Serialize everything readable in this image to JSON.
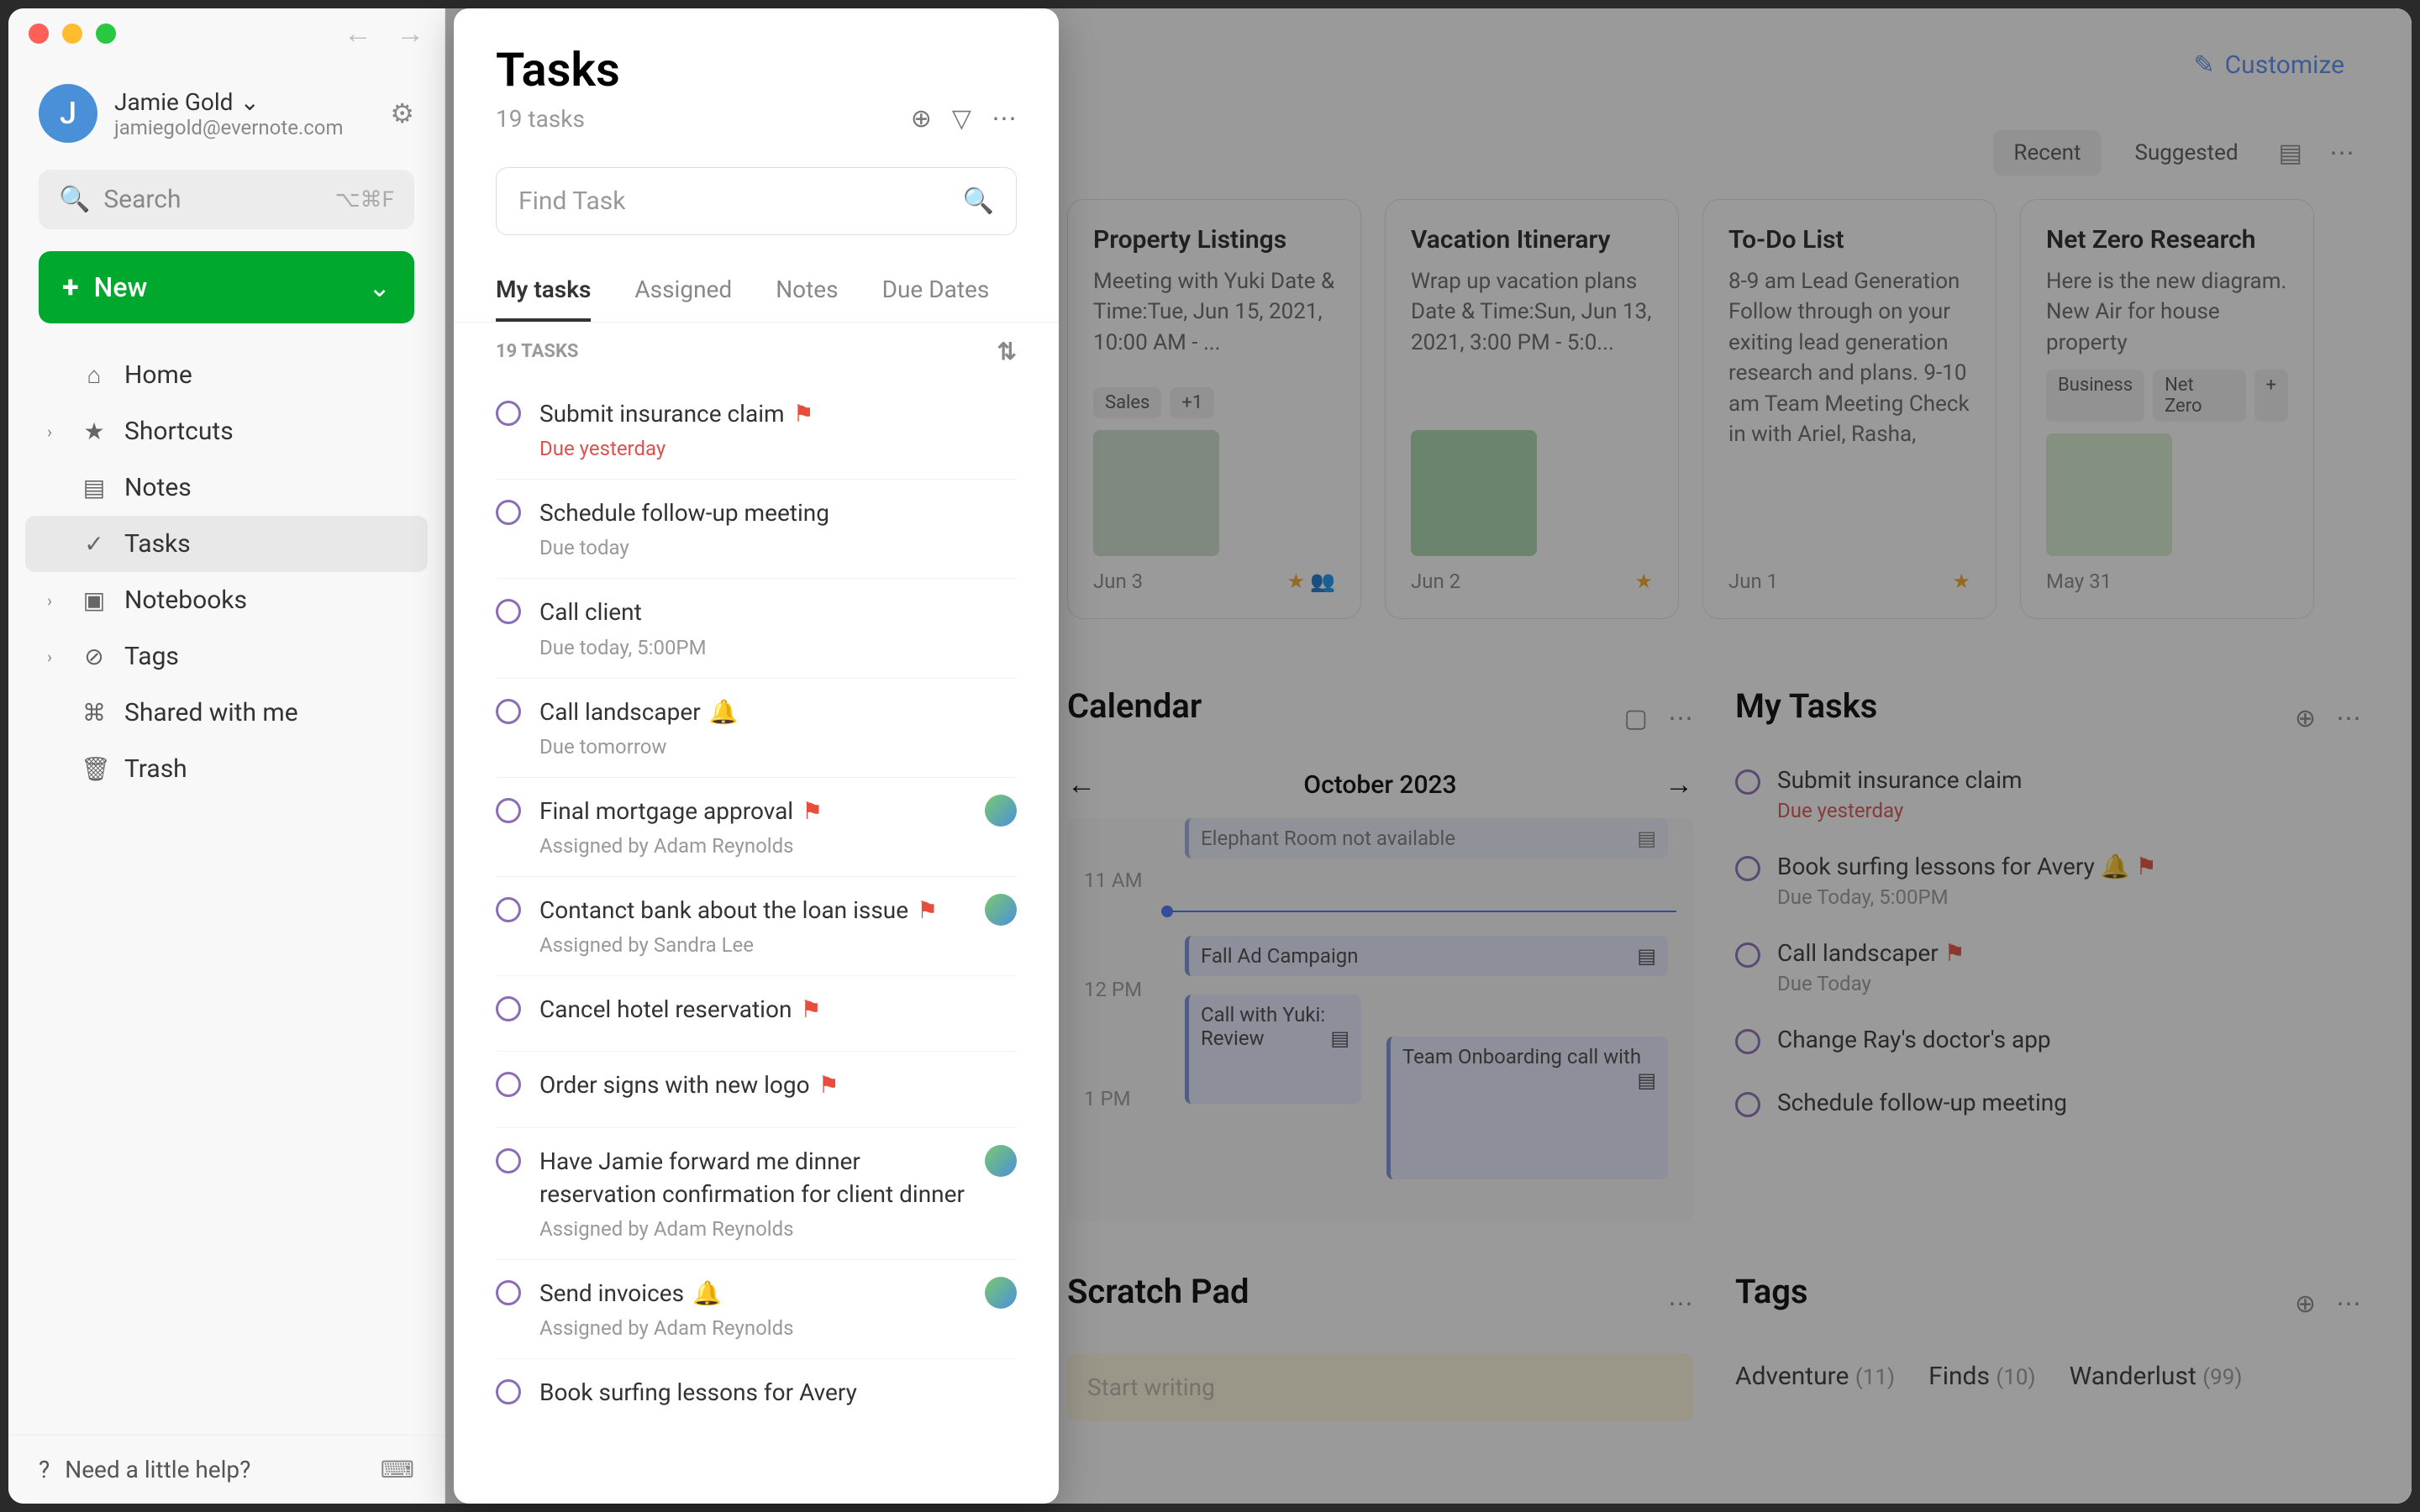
{
  "sidebar": {
    "traffic": [
      "red",
      "yellow",
      "green"
    ],
    "profile": {
      "initial": "J",
      "name": "Jamie Gold",
      "email": "jamiegold@evernote.com"
    },
    "search_placeholder": "Search",
    "search_kbd": "⌥⌘F",
    "new_label": "New",
    "nav": [
      {
        "label": "Home",
        "icon": "🏠",
        "expand": false
      },
      {
        "label": "Shortcuts",
        "icon": "★",
        "expand": true
      },
      {
        "label": "Notes",
        "icon": "📄",
        "expand": false
      },
      {
        "label": "Tasks",
        "icon": "✓",
        "expand": false,
        "active": true
      },
      {
        "label": "Notebooks",
        "icon": "📚",
        "expand": true
      },
      {
        "label": "Tags",
        "icon": "🏷",
        "expand": true
      },
      {
        "label": "Shared with me",
        "icon": "👥",
        "expand": false
      },
      {
        "label": "Trash",
        "icon": "🗑",
        "expand": false
      }
    ],
    "help_label": "Need a little help?"
  },
  "main": {
    "customize_label": "Customize",
    "notes_section": {
      "pills": {
        "recent": "Recent",
        "suggested": "Suggested"
      }
    },
    "cards": [
      {
        "title": "Property Listings",
        "body": "Meeting with Yuki Date & Time:Tue, Jun 15, 2021, 10:00 AM - ...",
        "tags": [
          "Sales",
          "+1"
        ],
        "date": "Jun 3",
        "thumb": true
      },
      {
        "title": "Vacation Itinerary",
        "body": "Wrap up vacation plans Date & Time:Sun, Jun 13, 2021, 3:00 PM - 5:0...",
        "tags": [],
        "date": "Jun 2",
        "thumb": true
      },
      {
        "title": "To-Do List",
        "body": "8-9 am Lead Generation Follow through on your exiting lead generation research and plans. 9-10 am Team Meeting Check in with Ariel, Rasha,",
        "tags": [],
        "date": "Jun 1",
        "thumb": false
      },
      {
        "title": "Net Zero Research",
        "body": "Here is the new diagram. New Air for house property",
        "tags": [
          "Business",
          "Net Zero",
          "+"
        ],
        "date": "May 31",
        "thumb": true
      }
    ],
    "calendar": {
      "title": "Calendar",
      "month": "October 2023",
      "times": [
        "11 AM",
        "12 PM",
        "1 PM"
      ],
      "events": [
        {
          "label": "Elephant Room not available"
        },
        {
          "label": "Fall Ad Campaign"
        },
        {
          "label": "Call with Yuki: Review"
        },
        {
          "label": "Team Onboarding call with"
        }
      ]
    },
    "my_tasks": {
      "title": "My Tasks",
      "items": [
        {
          "title": "Submit insurance claim",
          "sub": "Due yesterday",
          "sub_red": true
        },
        {
          "title": "Book surfing lessons for Avery",
          "sub": "Due Today, 5:00PM",
          "bell": true,
          "flag": true
        },
        {
          "title": "Call landscaper",
          "sub": "Due Today",
          "flag": true
        },
        {
          "title": "Change Ray's doctor's app",
          "sub": ""
        },
        {
          "title": "Schedule follow-up meeting",
          "sub": ""
        }
      ]
    },
    "scratch": {
      "title": "Scratch Pad",
      "placeholder": "Start writing"
    },
    "tags": {
      "title": "Tags",
      "items": [
        {
          "label": "Adventure",
          "count": "(11)"
        },
        {
          "label": "Finds",
          "count": "(10)"
        },
        {
          "label": "Wanderlust",
          "count": "(99)"
        }
      ]
    }
  },
  "popover": {
    "title": "Tasks",
    "subtitle": "19 tasks",
    "find_placeholder": "Find Task",
    "tabs": [
      "My tasks",
      "Assigned",
      "Notes",
      "Due Dates"
    ],
    "section_label": "19 TASKS",
    "tasks": [
      {
        "title": "Submit insurance claim",
        "flag": true,
        "meta": "Due yesterday",
        "meta_red": true
      },
      {
        "title": "Schedule follow-up meeting",
        "meta": "Due today"
      },
      {
        "title": "Call client",
        "meta": "Due today, 5:00PM"
      },
      {
        "title": "Call landscaper",
        "bell": true,
        "meta": "Due tomorrow"
      },
      {
        "title": "Final mortgage approval",
        "flag": true,
        "meta": "Assigned by Adam Reynolds",
        "assignee": true
      },
      {
        "title": "Contanct bank about the loan issue",
        "flag": true,
        "meta": "Assigned by Sandra Lee",
        "assignee": true
      },
      {
        "title": "Cancel hotel reservation",
        "flag": true
      },
      {
        "title": "Order signs with new logo",
        "flag": true
      },
      {
        "title": "Have Jamie forward me dinner reservation confirmation for client dinner",
        "meta": "Assigned by Adam Reynolds",
        "assignee": true
      },
      {
        "title": "Send invoices",
        "bell": true,
        "meta": "Assigned by Adam Reynolds",
        "assignee": true
      },
      {
        "title": "Book surfing lessons for Avery"
      }
    ]
  }
}
